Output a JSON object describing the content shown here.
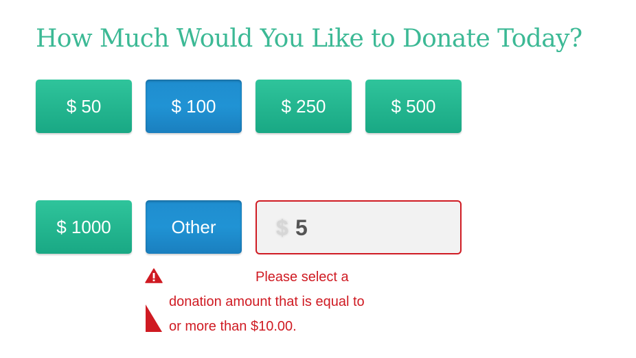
{
  "header": {
    "title": "How Much Would You Like to Donate Today?"
  },
  "amounts": [
    {
      "label": "$ 50"
    },
    {
      "label": "$ 100"
    },
    {
      "label": "$ 250"
    },
    {
      "label": "$ 500"
    },
    {
      "label": "$ 1000"
    },
    {
      "label": "Other"
    }
  ],
  "selected_amount": "Other",
  "custom_amount": {
    "currency_symbol": "$",
    "value": "5"
  },
  "error": {
    "icon": "warning-icon",
    "line1": "Please select a",
    "line2": "donation amount that is equal to",
    "line3": "or more than $10.00."
  },
  "colors": {
    "title": "#3cb995",
    "button_green": "#1fb08a",
    "button_blue": "#2093d4",
    "error_red": "#cf1a22"
  }
}
